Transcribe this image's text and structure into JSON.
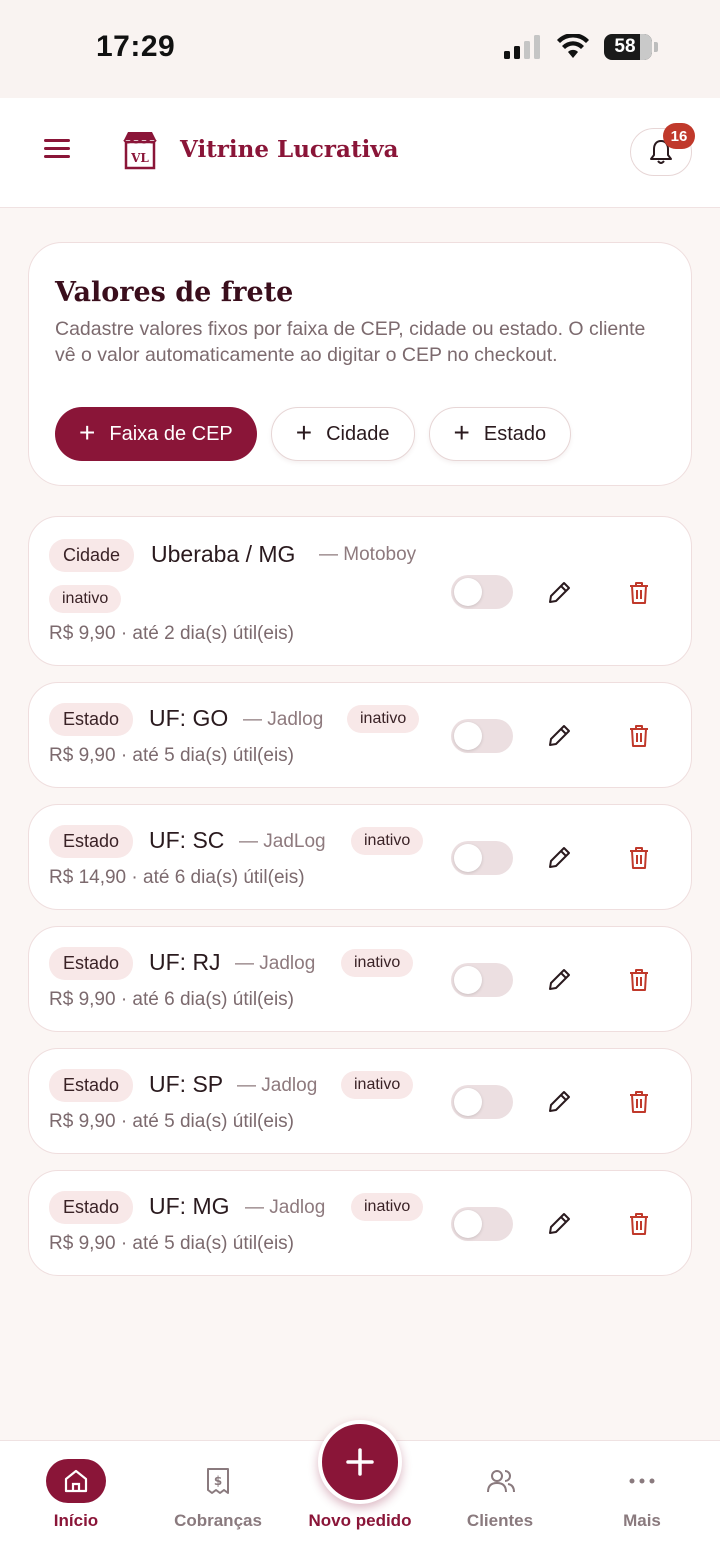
{
  "status_bar": {
    "time": "17:29",
    "battery": "58"
  },
  "header": {
    "brand": "Vitrine Lucrativa",
    "notification_count": "16"
  },
  "intro": {
    "title": "Valores de frete",
    "description": "Cadastre valores fixos por faixa de CEP, cidade ou estado. O cliente vê o valor automaticamente ao digitar o CEP no checkout.",
    "buttons": {
      "cep": "Faixa de CEP",
      "city": "Cidade",
      "state": "Estado"
    }
  },
  "rules": [
    {
      "type": "Cidade",
      "name": "Uberaba / MG",
      "carrier": "— Motoboy",
      "status": "inativo",
      "price": "R$ 9,90",
      "deadline": "· até 2 dia(s) útil(eis)"
    },
    {
      "type": "Estado",
      "name": "UF: GO",
      "carrier": "— Jadlog",
      "status": "inativo",
      "price": "R$ 9,90",
      "deadline": "· até 5 dia(s) útil(eis)"
    },
    {
      "type": "Estado",
      "name": "UF: SC",
      "carrier": "— JadLog",
      "status": "inativo",
      "price": "R$ 14,90",
      "deadline": "· até 6 dia(s) útil(eis)"
    },
    {
      "type": "Estado",
      "name": "UF: RJ",
      "carrier": "— Jadlog",
      "status": "inativo",
      "price": "R$ 9,90",
      "deadline": "· até 6 dia(s) útil(eis)"
    },
    {
      "type": "Estado",
      "name": "UF: SP",
      "carrier": "— Jadlog",
      "status": "inativo",
      "price": "R$ 9,90",
      "deadline": "· até 5 dia(s) útil(eis)"
    },
    {
      "type": "Estado",
      "name": "UF: MG",
      "carrier": "— Jadlog",
      "status": "inativo",
      "price": "R$ 9,90",
      "deadline": "· até 5 dia(s) útil(eis)"
    }
  ],
  "bottom_nav": {
    "home": "Início",
    "charges": "Cobranças",
    "new_order": "Novo pedido",
    "clients": "Clientes",
    "more": "Mais"
  },
  "colors": {
    "brand": "#8a1538",
    "danger": "#c0392b",
    "background": "#fbf6f4"
  }
}
